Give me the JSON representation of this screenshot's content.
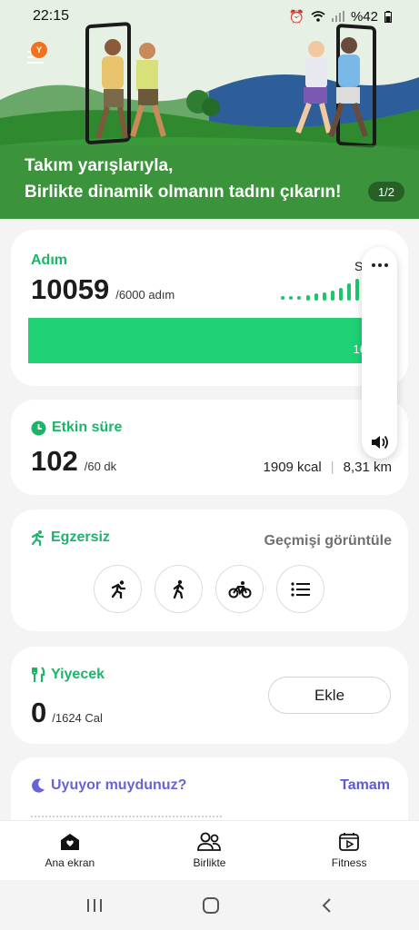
{
  "status_bar": {
    "time": "22:15",
    "battery": "%42"
  },
  "hero": {
    "line1": "Takım yarışlarıyla,",
    "line2": "Birlikte dinamik olmanın tadını çıkarın!",
    "page_indicator": "1/2",
    "badge": "Y",
    "accent_color": "#3e8e3e"
  },
  "steps": {
    "title": "Adım",
    "value": "10059",
    "goal": "/6000 adım",
    "progress_label": "16",
    "partial_label": "S",
    "progress_fraction": 1.0,
    "accent_color": "#1fd075"
  },
  "active": {
    "title": "Etkin süre",
    "value": "102",
    "goal": "/60 dk",
    "kcal": "1909 kcal",
    "distance": "8,31 km"
  },
  "exercise": {
    "title": "Egzersiz",
    "history_link": "Geçmişi görüntüle",
    "buttons": [
      "running-icon",
      "walking-icon",
      "cycling-icon",
      "list-icon"
    ]
  },
  "food": {
    "title": "Yiyecek",
    "value": "0",
    "goal": "/1624 Cal",
    "add_button": "Ekle"
  },
  "sleep": {
    "title": "Uyuyor muydunuz?",
    "ok_link": "Tamam",
    "accent_color": "#6a63d8"
  },
  "bottom_nav": {
    "items": [
      {
        "label": "Ana ekran",
        "icon": "home-icon"
      },
      {
        "label": "Birlikte",
        "icon": "people-icon"
      },
      {
        "label": "Fitness",
        "icon": "fitness-icon"
      }
    ]
  },
  "system_nav": [
    "recents-icon",
    "home-circle-icon",
    "back-icon"
  ]
}
